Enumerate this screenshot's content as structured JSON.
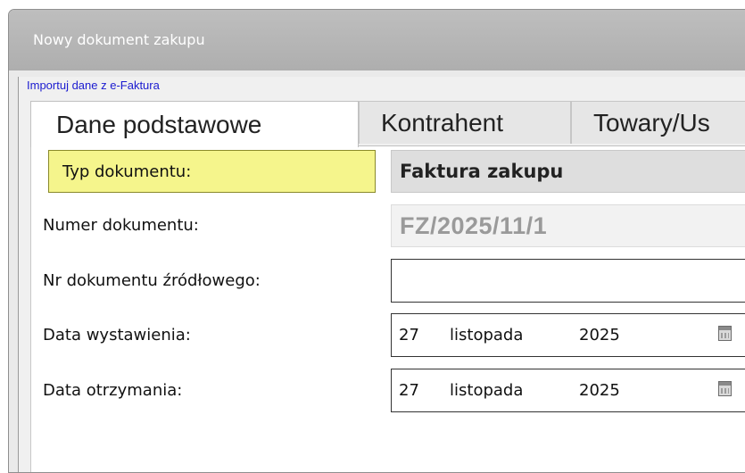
{
  "window": {
    "title": "Nowy dokument zakupu"
  },
  "import_link": "Importuj dane z e-Faktura",
  "tabs": [
    {
      "label": "Dane podstawowe",
      "active": true
    },
    {
      "label": "Kontrahent",
      "active": false
    },
    {
      "label": "Towary/Us",
      "active": false
    }
  ],
  "form": {
    "doc_type": {
      "label": "Typ dokumentu:",
      "value": "Faktura zakupu"
    },
    "doc_number": {
      "label": "Numer dokumentu:",
      "value": "FZ/2025/11/1"
    },
    "source_number": {
      "label": "Nr dokumentu źródłowego:",
      "value": ""
    },
    "issue_date": {
      "label": "Data wystawienia:",
      "day": "27",
      "month": "listopada",
      "year": "2025",
      "icon": "calendar-icon"
    },
    "receipt_date": {
      "label": "Data otrzymania:",
      "day": "27",
      "month": "listopada",
      "year": "2025",
      "icon": "calendar-icon"
    }
  },
  "colors": {
    "highlight": "#f5f58c",
    "link": "#1b1bd0",
    "titlebar": "#b4b4b4"
  }
}
